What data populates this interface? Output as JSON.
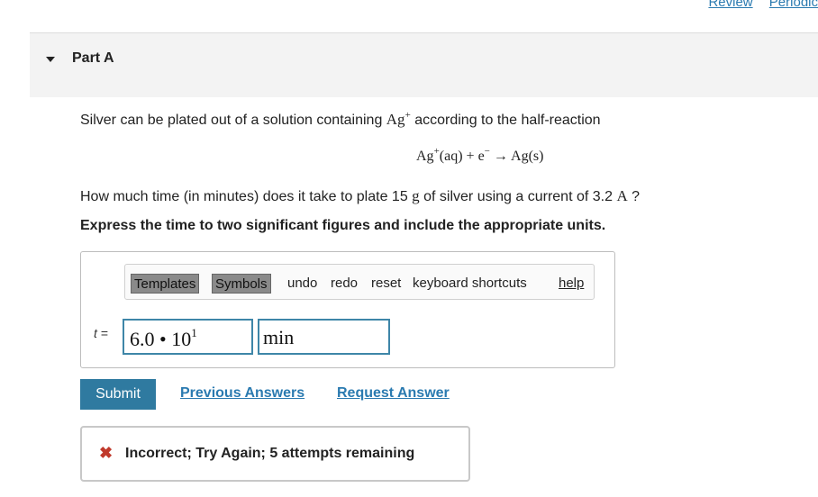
{
  "top_links": {
    "review": "Review",
    "periodic": "Periodic"
  },
  "part": {
    "title": "Part A"
  },
  "problem": {
    "intro_before": "Silver can be plated out of a solution containing ",
    "ion": "Ag",
    "ion_charge": "+",
    "intro_after": " according to the half-reaction",
    "equation": {
      "reactant_ion": "Ag",
      "reactant_charge": "+",
      "reactant_state": "(aq)",
      "plus": " + e",
      "electron_charge": "−",
      "arrow": " → ",
      "product": "Ag(s)"
    },
    "question_part1": "How much time (in minutes) does it take to plate 15 ",
    "question_unit_g": "g",
    "question_part2": " of silver using a current of 3.2 ",
    "question_unit_a": "A",
    "question_part3": " ?",
    "instruction": "Express the time to two significant figures and include the appropriate units."
  },
  "toolbar": {
    "templates": "Templates",
    "symbols": "Symbols",
    "undo": "undo",
    "redo": "redo",
    "reset": "reset",
    "shortcuts": "keyboard shortcuts",
    "help": "help"
  },
  "answer": {
    "variable": "t",
    "equals": "=",
    "value_mantissa": "6.0",
    "value_dot": " • ",
    "value_base": "10",
    "value_exponent": "1",
    "unit": "min"
  },
  "actions": {
    "submit": "Submit",
    "previous_answers": "Previous Answers",
    "request_answer": "Request Answer"
  },
  "feedback": {
    "icon": "✖",
    "message": "Incorrect; Try Again; 5 attempts remaining"
  },
  "colors": {
    "accent": "#2f7aa0",
    "link": "#2a7ab0",
    "error": "#c0392b"
  }
}
